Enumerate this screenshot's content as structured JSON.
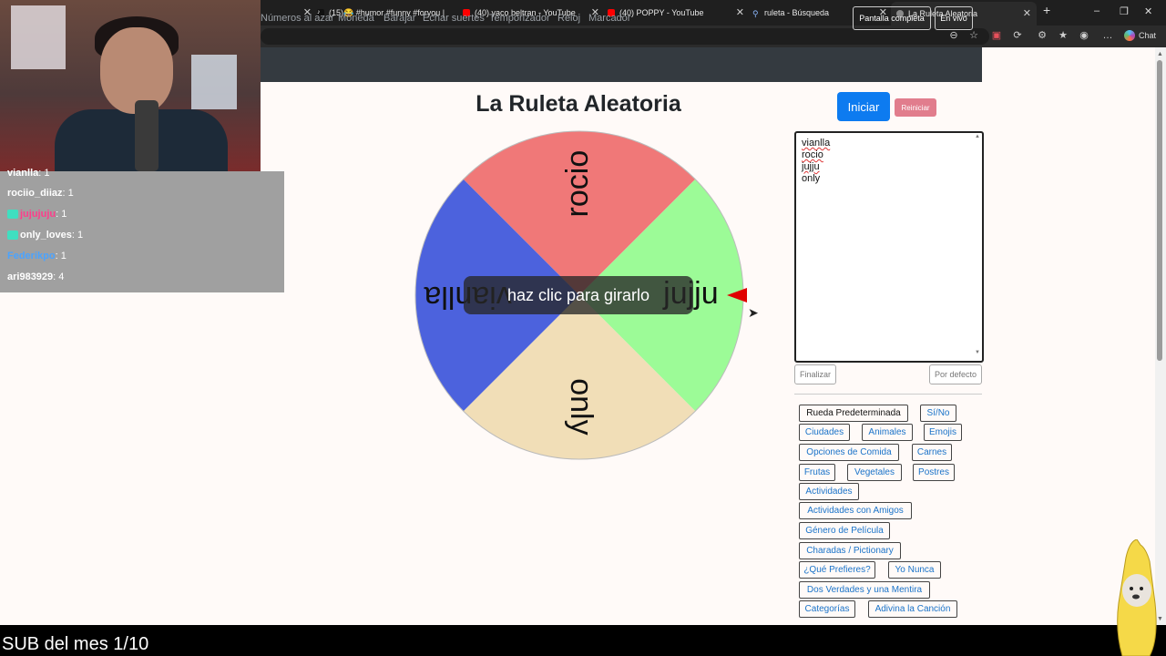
{
  "browser": {
    "tabs": [
      {
        "label": "",
        "icon": "generic-tab-icon"
      },
      {
        "label": "(15)😂 #humor #funny #foryou | ",
        "icon": "tiktok-icon"
      },
      {
        "label": "(40) yaco beltran - YouTube",
        "icon": "youtube-icon"
      },
      {
        "label": "(40) POPPY - YouTube",
        "icon": "youtube-icon"
      },
      {
        "label": "ruleta - Búsqueda",
        "icon": "search-icon"
      },
      {
        "label": "La Ruleta Aleatoria",
        "icon": "globe-icon",
        "active": true
      }
    ],
    "chat_label": "Chat"
  },
  "navbar": {
    "links": [
      "Números al azar",
      "Moneda",
      "Barajar",
      "Echar suertes",
      "Temporizador",
      "Reloj",
      "Marcador"
    ],
    "fullscreen_label": "Pantalla completa",
    "live_label": "En vivo"
  },
  "page": {
    "title": "La Ruleta Aleatoria",
    "start_label": "Iniciar",
    "reset_label": "Reiniciar",
    "hint": "haz clic para girarlo"
  },
  "wheel": {
    "segments": [
      {
        "label": "rocio",
        "color": "#f07878"
      },
      {
        "label": "jujju",
        "color": "#9cfb97"
      },
      {
        "label": "only",
        "color": "#f1deb7"
      },
      {
        "label": "vianlla",
        "color": "#4c62dd"
      }
    ],
    "pointer_color": "#e00000"
  },
  "names_list": [
    "vianlla",
    "rocio",
    "jujju",
    "only"
  ],
  "list_buttons": {
    "finish_label": "Finalizar",
    "default_label": "Por defecto"
  },
  "presets": [
    "Rueda Predeterminada",
    "Sí/No",
    "Ciudades",
    "Animales",
    "Emojis",
    "Opciones de Comida",
    "Carnes",
    "Frutas",
    "Vegetales",
    "Postres",
    "Actividades",
    "Actividades con Amigos",
    "Género de Película",
    "Charadas / Pictionary",
    "¿Qué Prefieres?",
    "Yo Nunca",
    "Dos Verdades y una Mentira",
    "Categorías",
    "Adivina la Canción"
  ],
  "stream_chat": [
    {
      "user": "vianlla",
      "count": "1"
    },
    {
      "user": "rociio_diiaz",
      "count": "1"
    },
    {
      "user": "jujujuju",
      "count": "1"
    },
    {
      "user": "only_loves",
      "count": "1"
    },
    {
      "user": "Federikpo",
      "count": "1"
    },
    {
      "user": "ari983929",
      "count": "4"
    }
  ],
  "stream_chat_colors": [
    "#ffffff",
    "#ffffff",
    "#ff3d8b",
    "#ffffff",
    "#4aa3ff",
    "#ffffff"
  ],
  "bottom_banner": "SUB del mes 1/10"
}
